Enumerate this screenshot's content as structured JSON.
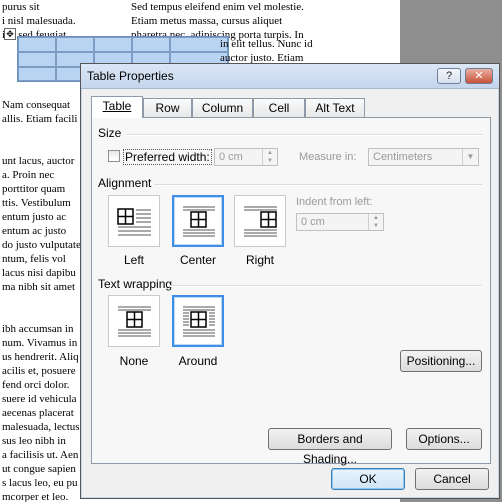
{
  "document": {
    "left_lines": [
      "purus sit",
      "i nisl malesuada.",
      "inc sed feugiat",
      "",
      "",
      "",
      "",
      "Nam consequat",
      "allis. Etiam facili",
      "",
      "",
      "unt lacus, auctor",
      "a. Proin nec",
      "porttitor quam",
      "ttis. Vestibulum",
      "entum justo ac",
      "entum ac justo",
      "do justo vulputate",
      "ntum, felis vol",
      "lacus nisi dapibu",
      "ma nibh sit amet",
      "",
      "",
      "ibh accumsan in",
      "num. Vivamus in",
      "us hendrerit. Aliq",
      "acilis et, posuere",
      "fend orci dolor.",
      "suere id vehicula",
      "aecenas placerat",
      "malesuada, lectus",
      "sus leo nibh in",
      "a facilisis ut. Aen",
      "ut congue sapien",
      "s lacus leo, eu pu",
      "mcorper et leo."
    ],
    "right_lines": [
      "Sed tempus eleifend enim vel molestie.",
      "Etiam metus massa, cursus aliquet",
      "pharetra nec, adipiscing porta turpis. In"
    ],
    "table_side_lines": [
      "in elit tellus. Nunc id",
      "auctor justo. Etiam"
    ]
  },
  "dialog": {
    "title": "Table Properties",
    "help_label": "?",
    "close_label": "✕",
    "tabs": [
      {
        "label": "Table",
        "active": true
      },
      {
        "label": "Row",
        "active": false
      },
      {
        "label": "Column",
        "active": false
      },
      {
        "label": "Cell",
        "active": false
      },
      {
        "label": "Alt Text",
        "active": false
      }
    ],
    "size": {
      "section_label": "Size",
      "preferred_width_label": "Preferred width:",
      "preferred_width_checked": false,
      "preferred_width_value": "0 cm",
      "measure_in_label": "Measure in:",
      "measure_in_value": "Centimeters"
    },
    "alignment": {
      "section_label": "Alignment",
      "options": [
        "Left",
        "Center",
        "Right"
      ],
      "selected": "Center",
      "indent_label": "Indent from left:",
      "indent_value": "0 cm"
    },
    "text_wrapping": {
      "section_label": "Text wrapping",
      "options": [
        "None",
        "Around"
      ],
      "selected": "Around",
      "positioning_label": "Positioning..."
    },
    "borders_label": "Borders and Shading...",
    "options_label": "Options...",
    "ok_label": "OK",
    "cancel_label": "Cancel"
  },
  "colors": {
    "selection_blue": "#3e8ee6",
    "disabled_text": "#9a9a9a"
  }
}
